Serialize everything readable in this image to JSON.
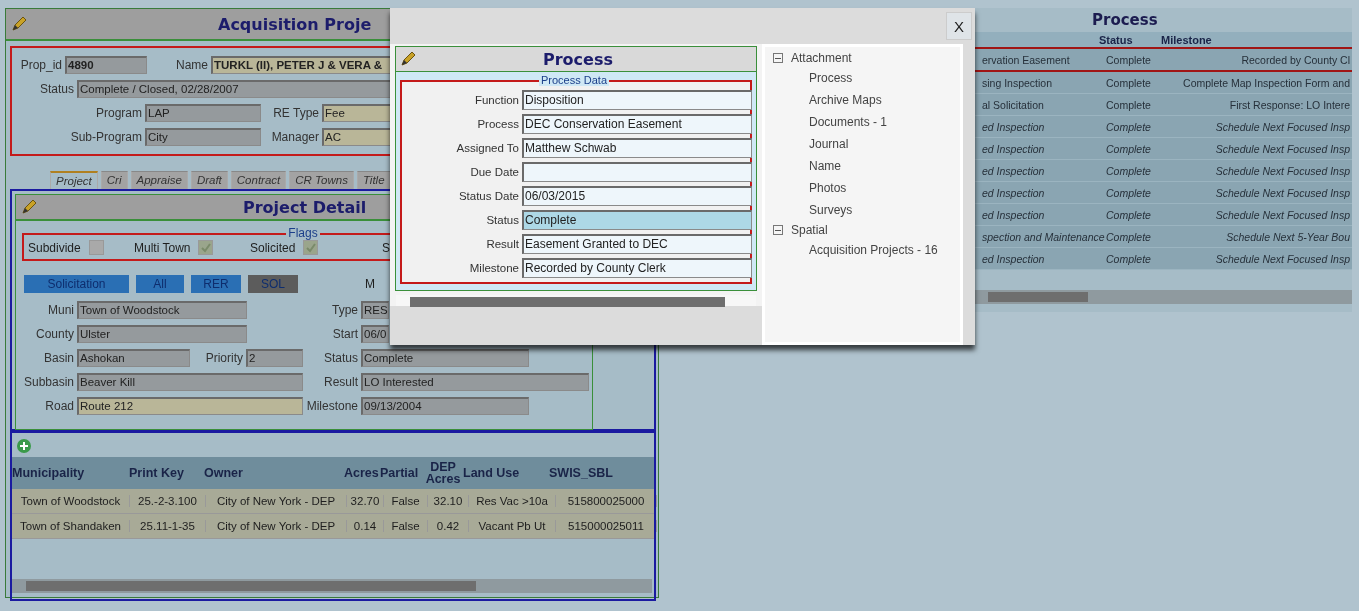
{
  "main": {
    "title": "Acquisition Proje",
    "property": {
      "prop_id": {
        "label": "Prop_id",
        "value": "4890"
      },
      "name": {
        "label": "Name",
        "value": "TURKL (II), PETER J & VERA &",
        "highlight": true
      },
      "status": {
        "label": "Status",
        "value": "Complete / Closed,  02/28/2007"
      },
      "program": {
        "label": "Program",
        "value": "LAP"
      },
      "re_type": {
        "label": "RE Type",
        "value": "Fee",
        "highlight": true
      },
      "sub_program": {
        "label": "Sub-Program",
        "value": "City"
      },
      "manager": {
        "label": "Manager",
        "value": "AC",
        "highlight": true
      }
    },
    "tabs": [
      {
        "label": "Project",
        "selected": true
      },
      {
        "label": "Cri",
        "selected": false
      },
      {
        "label": "Appraise",
        "selected": false
      },
      {
        "label": "Draft",
        "selected": false
      },
      {
        "label": "Contract",
        "selected": false
      },
      {
        "label": "CR Towns",
        "selected": false
      },
      {
        "label": "Title",
        "selected": false
      }
    ],
    "detail": {
      "title": "Project Detail",
      "flags_legend": "Flags",
      "flags": [
        {
          "label": "Subdivide",
          "checked": false
        },
        {
          "label": "Multi Town",
          "checked": true
        },
        {
          "label": "Solicited",
          "checked": true
        }
      ],
      "flag_cut_label": "S",
      "buttons": [
        {
          "label": "Solicitation",
          "color": "#2a6fb4"
        },
        {
          "label": "All",
          "color": "#2a6fb4"
        },
        {
          "label": "RER",
          "color": "#2a6fb4"
        },
        {
          "label": "SOL",
          "color": "#5c5c5c"
        }
      ],
      "button_row_cut_label": "M",
      "left_fields": [
        {
          "label": "Muni",
          "value": "Town of Woodstock",
          "highlight": false
        },
        {
          "label": "County",
          "value": "Ulster",
          "highlight": false
        },
        {
          "label": "Basin",
          "value": "Ashokan",
          "highlight": false
        },
        {
          "label": "Subbasin",
          "value": "Beaver Kill",
          "highlight": false
        },
        {
          "label": "Road",
          "value": "Route 212",
          "highlight": true
        }
      ],
      "priority": {
        "label": "Priority",
        "value": "2"
      },
      "right_fields": [
        {
          "label": "Type",
          "value": "RES"
        },
        {
          "label": "Start",
          "value": "06/0"
        },
        {
          "label": "Status",
          "value": "Complete"
        },
        {
          "label": "Result",
          "value": "LO Interested"
        },
        {
          "label": "Milestone",
          "value": "09/13/2004"
        }
      ]
    },
    "parcels": {
      "columns": [
        "Municipality",
        "Print Key",
        "Owner",
        "Acres",
        "Partial",
        "DEP Acres",
        "Land Use",
        "SWIS_SBL"
      ],
      "rows": [
        [
          "Town of Woodstock",
          "25.-2-3.100",
          "City of New York - DEP",
          "32.70",
          "False",
          "32.10",
          "Res Vac >10a",
          "515800025000"
        ],
        [
          "Town of Shandaken",
          "25.11-1-35",
          "City of New York - DEP",
          "0.14",
          "False",
          "0.42",
          "Vacant Pb Ut",
          "515000025011"
        ]
      ]
    }
  },
  "process_list": {
    "title": "Process",
    "columns": [
      "Status",
      "Milestone"
    ],
    "rows": [
      {
        "process": "ervation Easement",
        "status": "Complete",
        "milestone": "Recorded by County Cl",
        "kind": "normal",
        "selected": true
      },
      {
        "process": "sing Inspection",
        "status": "Complete",
        "milestone": "Complete Map Inspection Form and",
        "kind": "normal",
        "selected": false
      },
      {
        "process": "al Solicitation",
        "status": "Complete",
        "milestone": "First Response: LO Intere",
        "kind": "normal",
        "selected": false
      },
      {
        "process": "ed Inspection",
        "status": "Complete",
        "milestone": "Schedule Next Focused Insp",
        "kind": "scheduled",
        "selected": false
      },
      {
        "process": "ed Inspection",
        "status": "Complete",
        "milestone": "Schedule Next Focused Insp",
        "kind": "scheduled",
        "selected": false
      },
      {
        "process": "ed Inspection",
        "status": "Complete",
        "milestone": "Schedule Next Focused Insp",
        "kind": "scheduled",
        "selected": false
      },
      {
        "process": "ed Inspection",
        "status": "Complete",
        "milestone": "Schedule Next Focused Insp",
        "kind": "scheduled",
        "selected": false
      },
      {
        "process": "ed Inspection",
        "status": "Complete",
        "milestone": "Schedule Next Focused Insp",
        "kind": "scheduled",
        "selected": false
      },
      {
        "process": "spection and Maintenance",
        "status": "Complete",
        "milestone": "Schedule Next 5-Year Bou",
        "kind": "scheduled",
        "selected": false
      },
      {
        "process": "ed Inspection",
        "status": "Complete",
        "milestone": "Schedule Next Focused Insp",
        "kind": "scheduled",
        "selected": false
      }
    ]
  },
  "dialog": {
    "close": "X",
    "title": "Process",
    "legend": "Process Data",
    "fields": [
      {
        "label": "Function",
        "value": "Disposition",
        "highlight": false
      },
      {
        "label": "Process",
        "value": "DEC Conservation Easement",
        "highlight": false
      },
      {
        "label": "Assigned To",
        "value": "Matthew Schwab",
        "highlight": false
      },
      {
        "label": "Due Date",
        "highlight": false
      },
      {
        "label": "Status Date",
        "value": "06/03/2015",
        "highlight": false
      },
      {
        "label": "Status",
        "value": "Complete",
        "highlight": true
      },
      {
        "label": "Result",
        "value": "Easement Granted to DEC",
        "highlight": false
      },
      {
        "label": "Milestone",
        "value": "Recorded by County Clerk",
        "highlight": false
      }
    ],
    "tree": [
      {
        "label": "Attachment",
        "expanded": true,
        "children": [
          {
            "label": "Process"
          },
          {
            "label": "Archive Maps"
          },
          {
            "label": "Documents - 1"
          },
          {
            "label": "Journal"
          },
          {
            "label": "Name"
          },
          {
            "label": "Photos"
          },
          {
            "label": "Surveys"
          }
        ]
      },
      {
        "label": "Spatial",
        "expanded": true,
        "children": [
          {
            "label": "Acquisition Projects - 16"
          }
        ]
      }
    ]
  }
}
